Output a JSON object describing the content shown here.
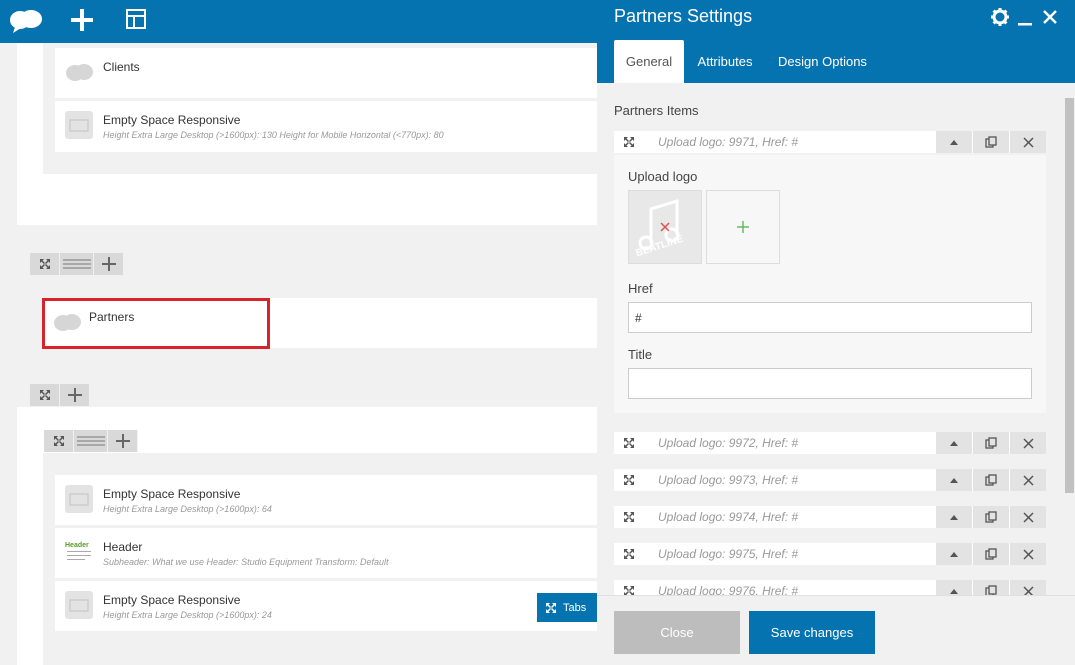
{
  "toolbar": {
    "logo_icon": "cloud-logo-icon",
    "add_icon": "plus-icon",
    "layout_icon": "layout-icon"
  },
  "editor": {
    "elements_top": [
      {
        "title": "Clients",
        "subtitle": "",
        "icon": "cloud-icon"
      },
      {
        "title": "Empty Space Responsive",
        "subtitle": "Height Extra Large Desktop (>1600px): 130  Height for Mobile Horizontal (<770px): 80",
        "icon": "box-icon"
      }
    ],
    "partners_element": {
      "title": "Partners",
      "icon": "cloud-icon"
    },
    "elements_bottom": [
      {
        "title": "Empty Space Responsive",
        "subtitle": "Height Extra Large Desktop (>1600px): 64",
        "icon": "box-icon"
      },
      {
        "title": "Header",
        "subtitle": "Subheader: What we use  Header: Studio Equipment  Transform: Default",
        "icon": "header-icon",
        "icon_text": "Header"
      },
      {
        "title": "Empty Space Responsive",
        "subtitle": "Height Extra Large Desktop (>1600px): 24",
        "icon": "box-icon"
      }
    ],
    "tabs_button": "Tabs"
  },
  "modal": {
    "title": "Partners Settings",
    "tabs": [
      {
        "label": "General",
        "active": true
      },
      {
        "label": "Attributes",
        "active": false
      },
      {
        "label": "Design Options",
        "active": false
      }
    ],
    "items_label": "Partners Items",
    "expanded_item": {
      "header": "Upload logo: 9971, Href: #",
      "upload_label": "Upload logo",
      "logo_text": "BEATLINE",
      "href_label": "Href",
      "href_value": "#",
      "title_label": "Title",
      "title_value": ""
    },
    "items": [
      "Upload logo: 9972, Href: #",
      "Upload logo: 9973, Href: #",
      "Upload logo: 9974, Href: #",
      "Upload logo: 9975, Href: #",
      "Upload logo: 9976, Href: #"
    ],
    "close_label": "Close",
    "save_label": "Save changes"
  },
  "colors": {
    "primary": "#0573b0",
    "highlight": "#d8232a",
    "add": "#5cb85c"
  }
}
